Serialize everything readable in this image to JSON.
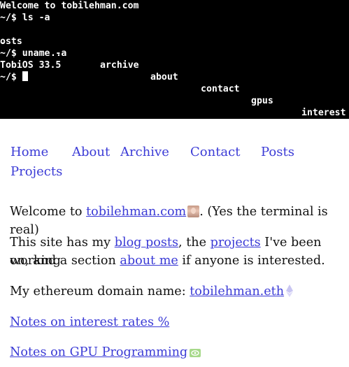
{
  "terminal": {
    "lines": [
      "Welcome to tobilehman.com",
      "~/$ ls -a",
      "",
      "osts",
      "~/$ uname -a",
      "TobiOS 33.5"
    ],
    "ls_items": [
      ".",
      "..",
      "archive",
      "about",
      "contact",
      "gpus",
      "interest"
    ],
    "prompt": "~/$ "
  },
  "nav": {
    "items": [
      "Home",
      "About",
      "Archive",
      "Contact",
      "Posts",
      "Projects"
    ]
  },
  "intro": {
    "welcome_prefix": "Welcome to ",
    "site_link": "tobilehman.com",
    "terminal_note": ". (Yes the terminal is real)",
    "blog_prefix": "This site has my ",
    "blog_link": "blog posts",
    "blog_mid": ", the ",
    "projects_link": "projects",
    "blog_suffix": " I've been working",
    "line2_prefix": "on, and a section ",
    "about_link": "about me",
    "line2_suffix": " if anyone is interested.",
    "eth_prefix": "My ethereum domain name: ",
    "eth_link": "tobilehman.eth"
  },
  "links": {
    "interest_rates": "Notes on interest rates %",
    "gpu_programming": "Notes on GPU Programming"
  },
  "colors": {
    "link": "#3b3bd6",
    "terminal_bg": "#000000",
    "terminal_fg": "#ffffff"
  },
  "icons": [
    "avatar-photo",
    "ethereum-icon",
    "nvidia-icon"
  ]
}
